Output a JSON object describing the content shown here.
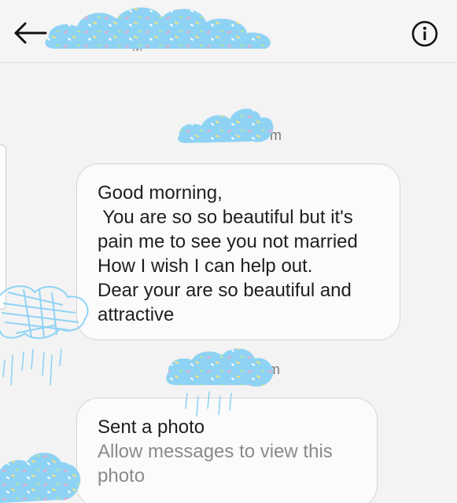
{
  "header": {
    "back_icon": "arrow-left-icon",
    "contact_name": "M",
    "info_icon": "info-circle-icon"
  },
  "messages": [
    {
      "sender": "m",
      "lines": [
        "Good morning,",
        " You are so so beautiful but it's",
        "pain me to see you not married",
        "How I wish I can help out.",
        "Dear your are so beautiful and",
        "attractive"
      ]
    },
    {
      "sender": "m",
      "title": "Sent a photo",
      "subtitle_lines": [
        "Allow messages to view this",
        "photo"
      ]
    }
  ],
  "colors": {
    "background": "#f3f3f3",
    "bubble_border": "#d6d6d6",
    "cloud_fill": "#8fd3f4",
    "muted_text": "#8a8a8a"
  }
}
